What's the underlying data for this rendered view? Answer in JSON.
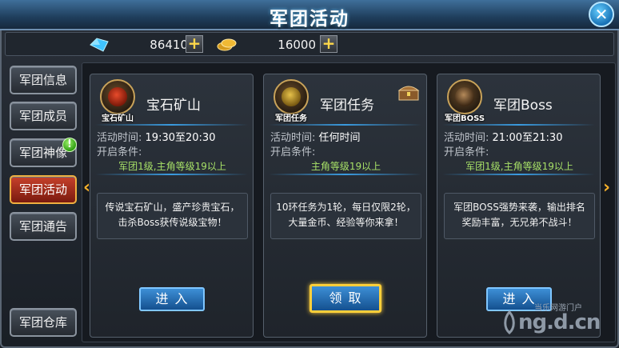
{
  "window": {
    "title": "军团活动",
    "close_label": "✕"
  },
  "currency": {
    "gem": {
      "icon": "gem-icon",
      "value": "86410",
      "plus": "+"
    },
    "gold": {
      "icon": "gold-coin-icon",
      "value": "16000",
      "plus": "+"
    }
  },
  "sidebar": {
    "items": [
      {
        "label": "军团信息",
        "active": false
      },
      {
        "label": "军团成员",
        "active": false
      },
      {
        "label": "军团神像",
        "active": false,
        "badge": "!"
      },
      {
        "label": "军团活动",
        "active": true
      },
      {
        "label": "军团通告",
        "active": false
      },
      {
        "label": "军团仓库",
        "active": false
      }
    ]
  },
  "nav": {
    "left_arrow": "‹",
    "right_arrow": "›"
  },
  "cards": [
    {
      "emblem_label": "宝石矿山",
      "title": "宝石矿山",
      "time_label": "活动时间:",
      "time_value": "19:30至20:30",
      "cond_label": "开启条件:",
      "cond_value": "军团1级,主角等级19以上",
      "desc": "传说宝石矿山，盛产珍贵宝石，击杀Boss获传说级宝物！",
      "button": "进入"
    },
    {
      "emblem_label": "军团任务",
      "title": "军团任务",
      "time_label": "活动时间:",
      "time_value": "任何时间",
      "cond_label": "开启条件:",
      "cond_value": "主角等级19以上",
      "desc": "10环任务为1轮，每日仅限2轮，大量金币、经验等你来拿！",
      "button": "领取"
    },
    {
      "emblem_label": "军团BOSS",
      "title": "军团Boss",
      "time_label": "活动时间:",
      "time_value": "21:00至21:30",
      "cond_label": "开启条件:",
      "cond_value": "军团1级,主角等级19以上",
      "desc": "军团BOSS强势来袭，输出排名奖励丰富，无兄弟不战斗！",
      "button": "进入"
    }
  ],
  "watermark": {
    "top": "当乐网游门户",
    "main": "ng.d.cn"
  },
  "colors": {
    "accent_blue": "#3d8fd6",
    "active_red": "#c7412b",
    "highlight_gold": "#ffcf3a",
    "condition_green": "#a7e067"
  }
}
